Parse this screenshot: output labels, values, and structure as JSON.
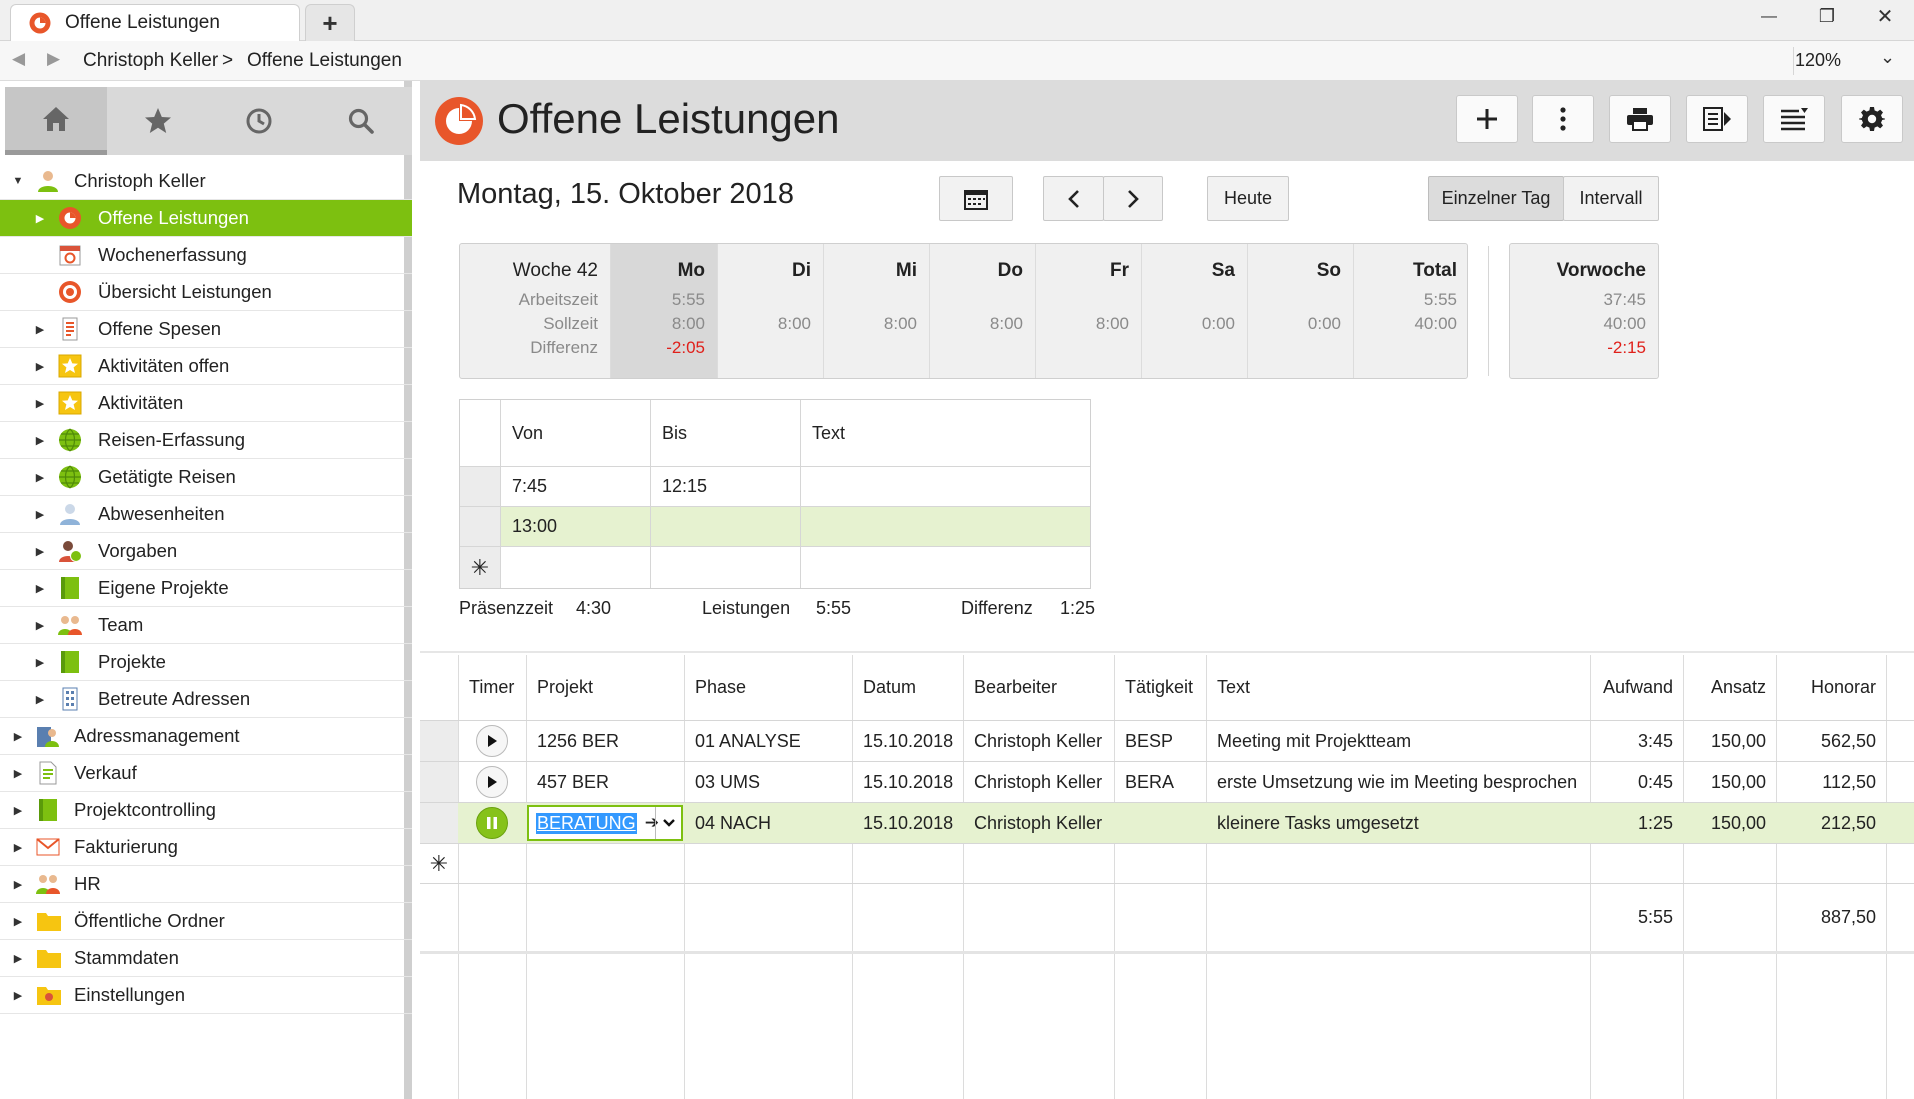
{
  "window": {
    "tab_title": "Offene Leistungen",
    "new_tab_label": "+",
    "minimize": "—",
    "maximize": "❐",
    "close": "✕"
  },
  "addressbar": {
    "back": "◀",
    "forward": "▶",
    "crumbs": [
      "Christoph Keller",
      ">",
      "Offene Leistungen"
    ],
    "zoom": "120%",
    "zoom_dropdown": "⌄"
  },
  "sidebar": {
    "tools": [
      {
        "name": "home-icon"
      },
      {
        "name": "star-icon"
      },
      {
        "name": "clock-icon"
      },
      {
        "name": "search-icon"
      }
    ],
    "tree": [
      {
        "label": "Christoph Keller",
        "level": 0,
        "expanded": true,
        "icon": "user-icon"
      },
      {
        "label": "Offene Leistungen",
        "level": 1,
        "selected": true,
        "icon": "pie-chart-icon"
      },
      {
        "label": "Wochenerfassung",
        "level": 1,
        "icon": "week-calendar-icon"
      },
      {
        "label": "Übersicht Leistungen",
        "level": 1,
        "icon": "target-icon"
      },
      {
        "label": "Offene Spesen",
        "level": 1,
        "icon": "receipt-icon"
      },
      {
        "label": "Aktivitäten offen",
        "level": 1,
        "icon": "activity-star-icon"
      },
      {
        "label": "Aktivitäten",
        "level": 1,
        "icon": "activity-star-icon"
      },
      {
        "label": "Reisen-Erfassung",
        "level": 1,
        "icon": "globe-icon"
      },
      {
        "label": "Getätigte Reisen",
        "level": 1,
        "icon": "globe-icon"
      },
      {
        "label": "Abwesenheiten",
        "level": 1,
        "icon": "absence-icon"
      },
      {
        "label": "Vorgaben",
        "level": 1,
        "icon": "user-clock-icon"
      },
      {
        "label": "Eigene Projekte",
        "level": 1,
        "icon": "project-book-icon"
      },
      {
        "label": "Team",
        "level": 1,
        "icon": "team-icon"
      },
      {
        "label": "Projekte",
        "level": 1,
        "icon": "project-book-icon"
      },
      {
        "label": "Betreute Adressen",
        "level": 1,
        "icon": "building-icon"
      },
      {
        "label": "Adressmanagement",
        "level": 0,
        "icon": "address-icon"
      },
      {
        "label": "Verkauf",
        "level": 0,
        "icon": "document-icon"
      },
      {
        "label": "Projektcontrolling",
        "level": 0,
        "icon": "project-book-icon"
      },
      {
        "label": "Fakturierung",
        "level": 0,
        "icon": "invoice-icon"
      },
      {
        "label": "HR",
        "level": 0,
        "icon": "team-icon"
      },
      {
        "label": "Öffentliche Ordner",
        "level": 0,
        "icon": "folder-icon"
      },
      {
        "label": "Stammdaten",
        "level": 0,
        "icon": "folder-icon"
      },
      {
        "label": "Einstellungen",
        "level": 0,
        "icon": "settings-folder-icon"
      }
    ]
  },
  "header": {
    "title": "Offene Leistungen",
    "buttons": [
      {
        "name": "add-button",
        "glyph": "+"
      },
      {
        "name": "more-button",
        "glyph": "⋮"
      },
      {
        "name": "print-button",
        "glyph": "print"
      },
      {
        "name": "export-button",
        "glyph": "export"
      },
      {
        "name": "list-options-button",
        "glyph": "list"
      },
      {
        "name": "settings-button",
        "glyph": "gear"
      }
    ]
  },
  "date_nav": {
    "title": "Montag, 15. Oktober 2018",
    "prev": "‹",
    "next": "›",
    "today": "Heute",
    "mode_single": "Einzelner Tag",
    "mode_interval": "Intervall",
    "active_mode": "single"
  },
  "week": {
    "label_col": {
      "head": "Woche 42",
      "rows": [
        "Arbeitszeit",
        "Sollzeit",
        "Differenz"
      ]
    },
    "days": [
      {
        "head": "Mo",
        "arbeitszeit": "5:55",
        "sollzeit": "8:00",
        "differenz": "-2:05",
        "active": true
      },
      {
        "head": "Di",
        "arbeitszeit": "",
        "sollzeit": "8:00",
        "differenz": ""
      },
      {
        "head": "Mi",
        "arbeitszeit": "",
        "sollzeit": "8:00",
        "differenz": ""
      },
      {
        "head": "Do",
        "arbeitszeit": "",
        "sollzeit": "8:00",
        "differenz": ""
      },
      {
        "head": "Fr",
        "arbeitszeit": "",
        "sollzeit": "8:00",
        "differenz": ""
      },
      {
        "head": "Sa",
        "arbeitszeit": "",
        "sollzeit": "0:00",
        "differenz": ""
      },
      {
        "head": "So",
        "arbeitszeit": "",
        "sollzeit": "0:00",
        "differenz": ""
      },
      {
        "head": "Total",
        "arbeitszeit": "5:55",
        "sollzeit": "40:00",
        "differenz": ""
      }
    ],
    "previous": {
      "head": "Vorwoche",
      "arbeitszeit": "37:45",
      "sollzeit": "40:00",
      "differenz": "-2:15"
    },
    "negative_color": "#e0201a"
  },
  "presence": {
    "columns": [
      "Von",
      "Bis",
      "Text"
    ],
    "rows": [
      {
        "von": "7:45",
        "bis": "12:15",
        "text": ""
      },
      {
        "von": "13:00",
        "bis": "",
        "text": "",
        "active": true
      }
    ],
    "new_row_marker": "✳",
    "summary": {
      "praesenz_label": "Präsenzzeit",
      "praesenz_value": "4:30",
      "leistungen_label": "Leistungen",
      "leistungen_value": "5:55",
      "differenz_label": "Differenz",
      "differenz_value": "1:25"
    }
  },
  "services": {
    "columns": [
      "Timer",
      "Projekt",
      "Phase",
      "Datum",
      "Bearbeiter",
      "Tätigkeit",
      "Text",
      "Aufwand",
      "Ansatz",
      "Honorar"
    ],
    "rows": [
      {
        "timer": "play",
        "projekt": "1256 BER",
        "phase": "01 ANALYSE",
        "datum": "15.10.2018",
        "bearbeiter": "Christoph Keller",
        "taetigkeit": "BESP",
        "text": "Meeting mit Projektteam",
        "aufwand": "3:45",
        "ansatz": "150,00",
        "honorar": "562,50"
      },
      {
        "timer": "play",
        "projekt": "457 BER",
        "phase": "03 UMS",
        "datum": "15.10.2018",
        "bearbeiter": "Christoph Keller",
        "taetigkeit": "BERA",
        "text": "erste Umsetzung wie im Meeting besprochen",
        "aufwand": "0:45",
        "ansatz": "150,00",
        "honorar": "112,50"
      },
      {
        "timer": "pause",
        "projekt": "BERATUNG",
        "phase": "04 NACH",
        "datum": "15.10.2018",
        "bearbeiter": "Christoph Keller",
        "taetigkeit": "",
        "text": "kleinere Tasks umgesetzt",
        "aufwand": "1:25",
        "ansatz": "150,00",
        "honorar": "212,50",
        "active": true,
        "editing": true
      }
    ],
    "new_row_marker": "✳",
    "totals": {
      "aufwand": "5:55",
      "honorar": "887,50"
    },
    "editor_arrow": "➔",
    "editor_dropdown": "⌄"
  },
  "colors": {
    "accent_green": "#7dc010",
    "active_row": "#e6f2d0",
    "brand_orange": "#e8562a",
    "selection_blue": "#3399ff"
  }
}
